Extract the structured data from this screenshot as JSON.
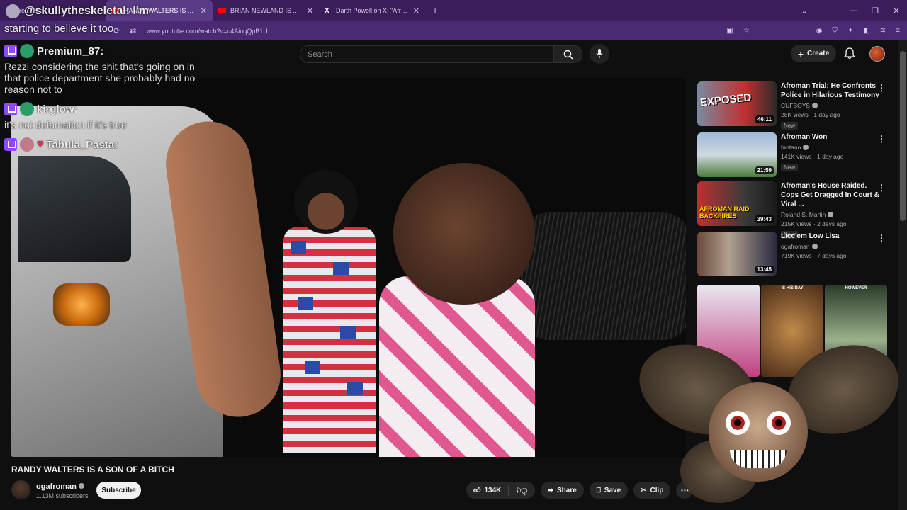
{
  "browser": {
    "tabs": [
      {
        "label": "YouTube",
        "icon": "youtube-icon"
      },
      {
        "label": "RANDY WALTERS IS A SON",
        "icon": "youtube-icon",
        "active": true
      },
      {
        "label": "BRIAN NEWLAND IS A FLAG - Y",
        "icon": "youtube-icon"
      },
      {
        "label": "Darth Powell on X: \"Afroman cl",
        "icon": "x-icon"
      }
    ],
    "url": "www.youtube.com/watch?v=u4AiuqQpB1U"
  },
  "overlay": {
    "username": "@skullytheskeletal: I'm",
    "subtext": "starting to believe it too",
    "chat": [
      {
        "user": "Premium_87:",
        "message": "Rezzi considering the shit that's going on in that police department she probably had no reason not to"
      },
      {
        "user": "kirglow:",
        "message": "it's not defamation if it's true"
      },
      {
        "user": "Tabula_Pasta:",
        "message": ""
      }
    ]
  },
  "youtube": {
    "search_placeholder": "Search",
    "create_label": "Create",
    "video_title": "RANDY WALTERS IS A SON OF A BITCH",
    "channel_name": "ogafroman",
    "channel_subs": "1.13M subscribers",
    "subscribe_label": "Subscribe",
    "likes": "134K",
    "share_label": "Share",
    "save_label": "Save",
    "clip_label": "Clip"
  },
  "recommendations": [
    {
      "title": "Afroman Trial: He Confronts Police in Hilarious Testimony",
      "channel": "CUFBOYS",
      "meta": "28K views · 1 day ago",
      "badge": "New",
      "duration": "46:11",
      "thumb_text": "EXPOSED"
    },
    {
      "title": "Afroman Won",
      "channel": "fantano",
      "meta": "141K views · 1 day ago",
      "badge": "New",
      "duration": "21:59",
      "thumb_text": ""
    },
    {
      "title": "Afroman's House Raided. Cops Get Dragged In Court & Viral ...",
      "channel": "Roland S. Martin",
      "meta": "215K views · 2 days ago",
      "badge": "New",
      "duration": "39:43",
      "thumb_text": "AFROMAN RAID BACKFIRES"
    },
    {
      "title": "Licc'em Low Lisa",
      "channel": "ogafroman",
      "meta": "719K views · 7 days ago",
      "badge": "",
      "duration": "13:45",
      "thumb_text": ""
    }
  ],
  "shorts": [
    {
      "label": ""
    },
    {
      "label": "IS HIS DAY"
    },
    {
      "label": "HOWEVER"
    }
  ],
  "colors": {
    "accent": "#ff0000",
    "tabbar": "#3b1d5c",
    "addrbar": "#4a2a73",
    "background": "#0f0f0f"
  }
}
